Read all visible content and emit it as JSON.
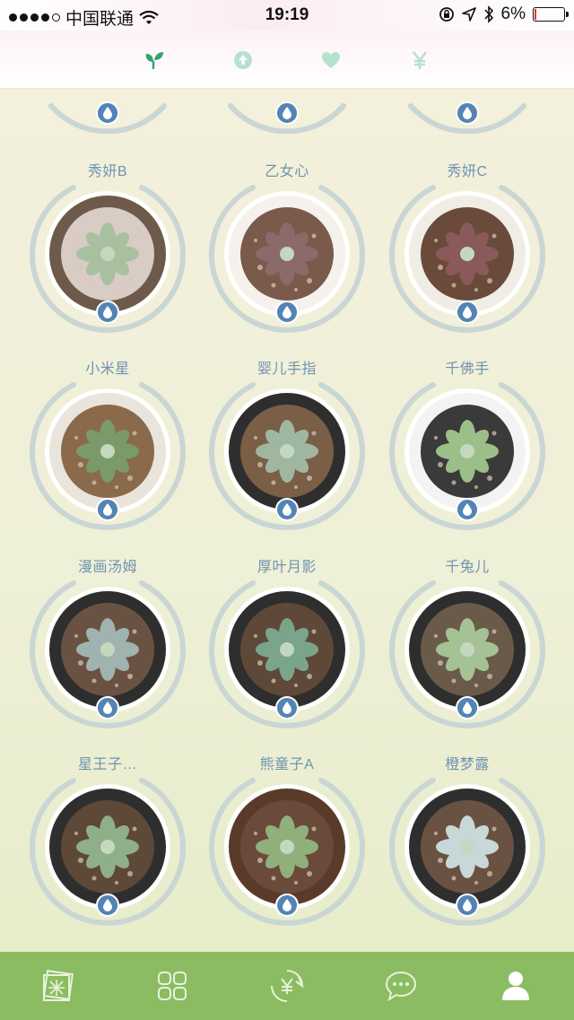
{
  "status_bar": {
    "carrier": "中国联通",
    "time": "19:19",
    "battery": "6%",
    "battery_level": 0.06
  },
  "top_tabs": [
    {
      "icon": "sprout-icon",
      "active": true
    },
    {
      "icon": "upload-icon",
      "active": false
    },
    {
      "icon": "heart-icon",
      "active": false
    },
    {
      "icon": "yen-icon",
      "active": false
    }
  ],
  "plants": [
    {
      "name": "秀妍B"
    },
    {
      "name": "乙女心"
    },
    {
      "name": "秀妍C"
    },
    {
      "name": "小米星"
    },
    {
      "name": "婴儿手指"
    },
    {
      "name": "千佛手"
    },
    {
      "name": "漫画汤姆"
    },
    {
      "name": "厚叶月影"
    },
    {
      "name": "千兔儿"
    },
    {
      "name": "星王子…"
    },
    {
      "name": "熊童子A"
    },
    {
      "name": "橙梦露"
    }
  ],
  "bottom_nav": [
    {
      "icon": "photo-frame-icon",
      "active": false
    },
    {
      "icon": "grid-icon",
      "active": false
    },
    {
      "icon": "yen-cycle-icon",
      "active": false
    },
    {
      "icon": "chat-icon",
      "active": false
    },
    {
      "icon": "user-icon",
      "active": true
    }
  ],
  "colors": {
    "accent_green": "#2fa56b",
    "nav_green": "#8cbc62",
    "name_blue": "#6f93b0",
    "water_blue": "#5384b4",
    "ring_gray": "#c9d6d4"
  }
}
